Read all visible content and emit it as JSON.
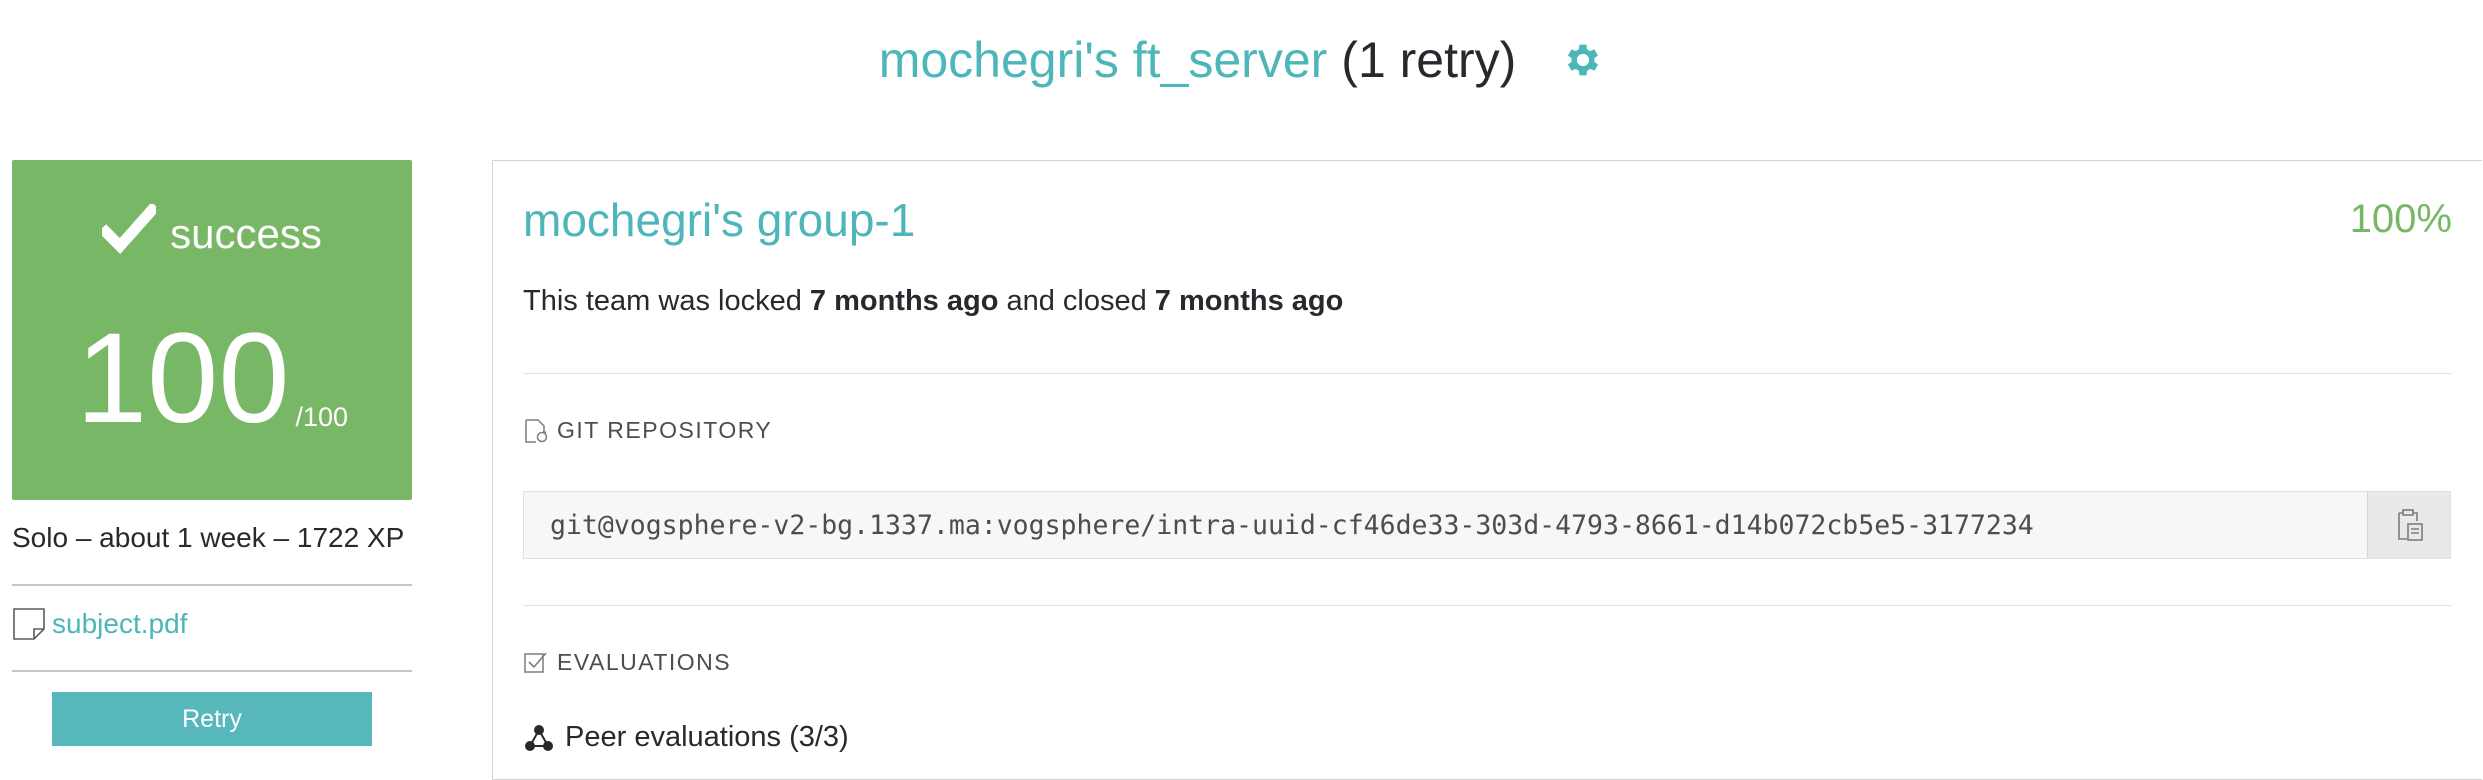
{
  "header": {
    "project_title": "mochegri's ft_server",
    "retry_count": "(1 retry)",
    "settings_icon": "gear-icon"
  },
  "score": {
    "status": "success",
    "value": "100",
    "max": "/100"
  },
  "meta": {
    "details": "Solo – about 1 week – 1722 XP"
  },
  "subject": {
    "label": "subject.pdf"
  },
  "retry_button": {
    "label": "Retry"
  },
  "team": {
    "name": "mochegri's group-1",
    "percent": "100%",
    "status_prefix": "This team was locked ",
    "locked_time": "7 months ago",
    "status_middle": " and closed ",
    "closed_time": "7 months ago"
  },
  "git": {
    "section_title": "GIT REPOSITORY",
    "url": "git@vogsphere-v2-bg.1337.ma:vogsphere/intra-uuid-cf46de33-303d-4793-8661-d14b072cb5e5-3177234"
  },
  "evaluations": {
    "section_title": "EVALUATIONS",
    "peer_label": "Peer evaluations (3/3)"
  },
  "colors": {
    "accent": "#4db6b9",
    "success": "#78b765",
    "text": "#26292d"
  }
}
